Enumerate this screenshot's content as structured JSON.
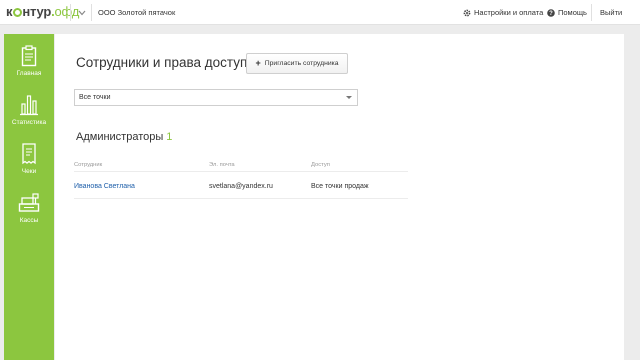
{
  "header": {
    "logo": {
      "k": "к",
      "ntur": "нтур",
      "dot": ".",
      "ofd": "офд"
    },
    "org_name": "ООО Золотой пятачок",
    "settings_label": "Настройки и оплата",
    "help_label": "Помощь",
    "logout_label": "Выйти"
  },
  "sidebar": {
    "items": [
      {
        "label": "Главная",
        "icon": "clipboard-icon"
      },
      {
        "label": "Статистика",
        "icon": "bar-chart-icon"
      },
      {
        "label": "Чеки",
        "icon": "receipt-icon"
      },
      {
        "label": "Кассы",
        "icon": "cash-register-icon"
      }
    ]
  },
  "main": {
    "title": "Сотрудники и права доступа",
    "invite_button": "Пригласить сотрудника",
    "filter_select": "Все точки",
    "section": {
      "title": "Администраторы",
      "count": "1"
    },
    "table": {
      "columns": [
        "Сотрудник",
        "Эл. почта",
        "Доступ"
      ],
      "rows": [
        {
          "name": "Иванова Светлана",
          "email": "svetlana@yandex.ru",
          "access": "Все точки продаж"
        }
      ]
    }
  },
  "colors": {
    "accent": "#8cc63f",
    "link": "#1e5faa",
    "background": "#ececec"
  }
}
